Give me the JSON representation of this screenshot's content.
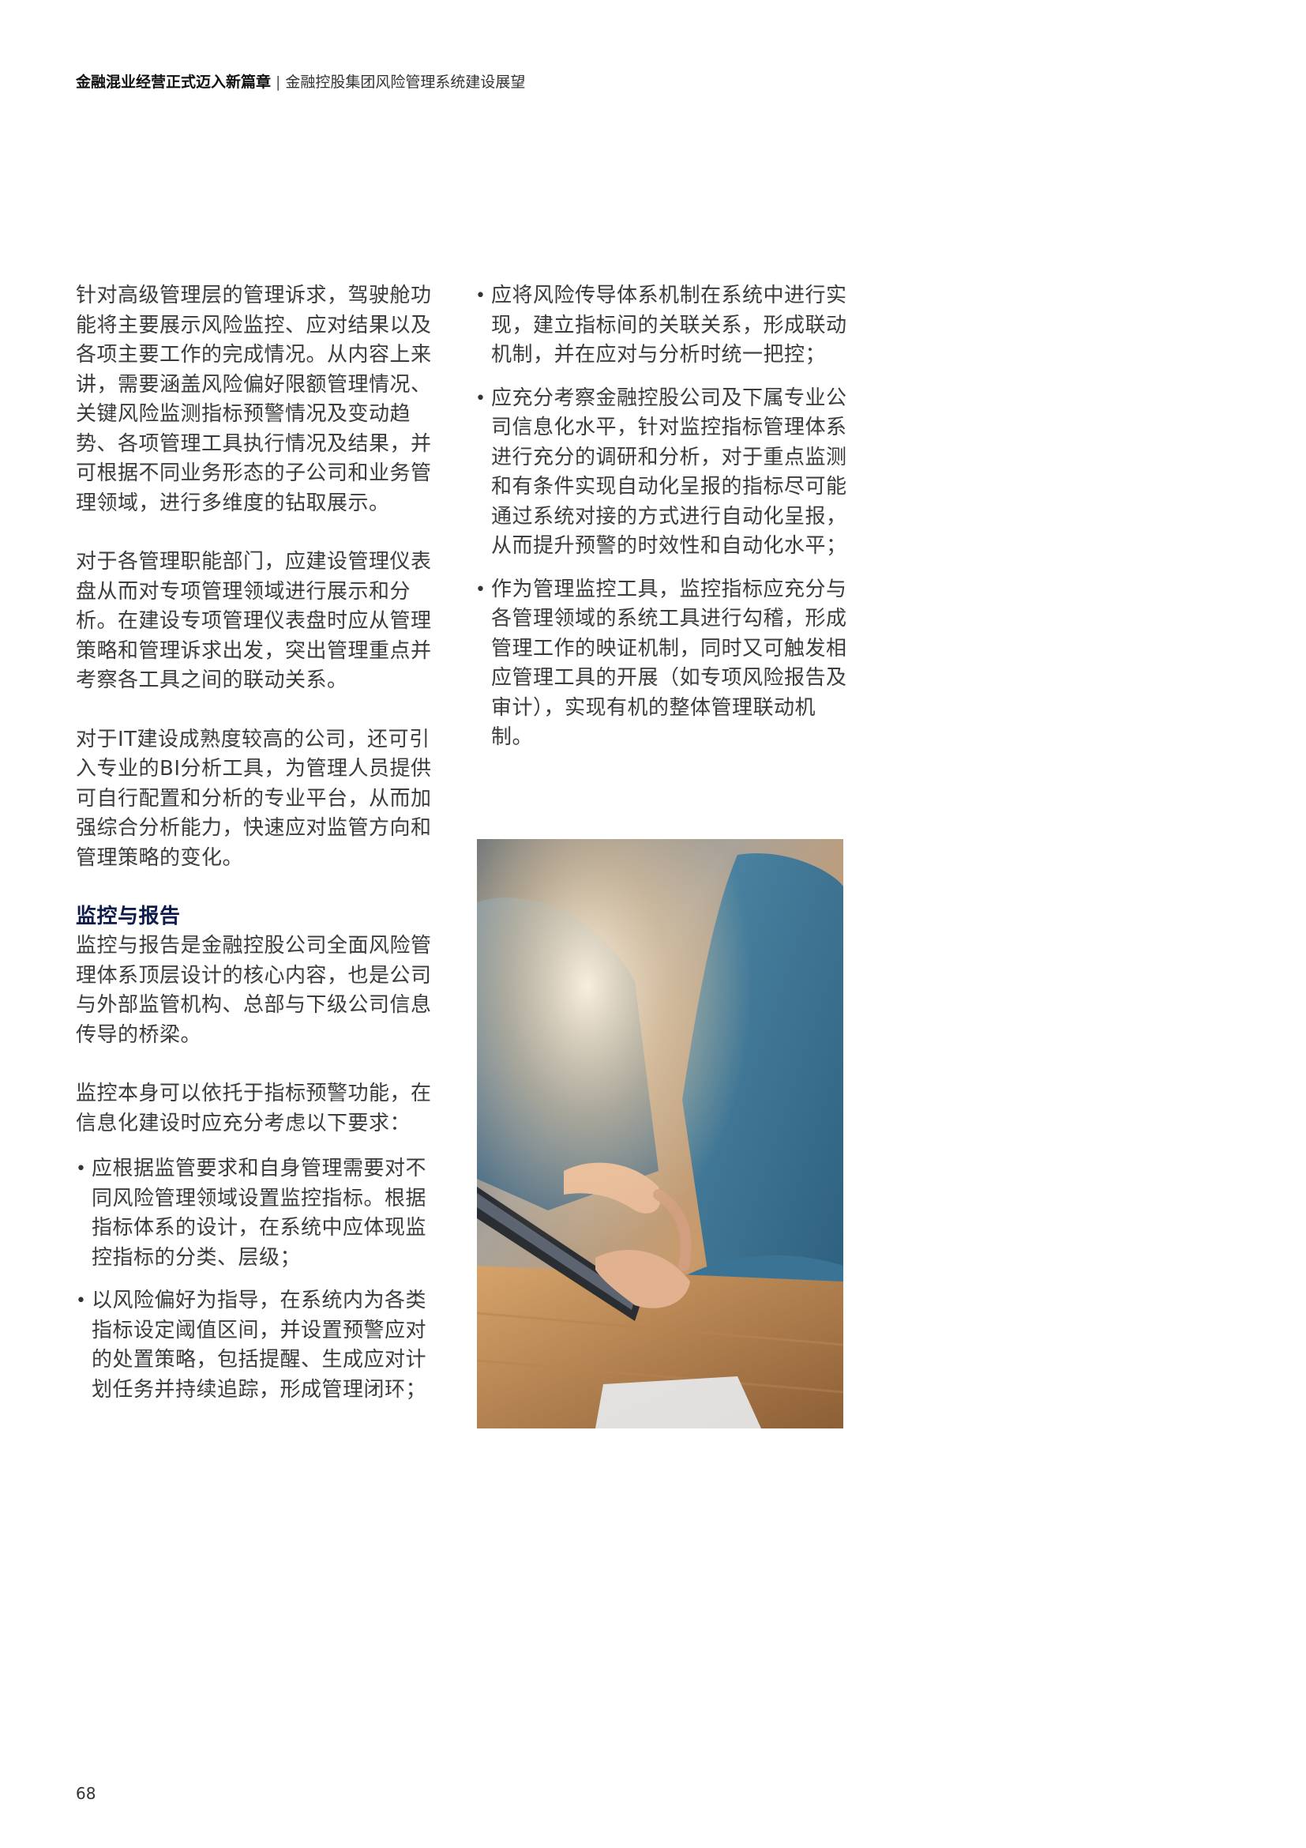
{
  "header": {
    "title": "金融混业经营正式迈入新篇章",
    "separator": "|",
    "subtitle": "金融控股集团风险管理系统建设展望"
  },
  "left_column": {
    "paragraphs": [
      "针对高级管理层的管理诉求，驾驶舱功能将主要展示风险监控、应对结果以及各项主要工作的完成情况。从内容上来讲，需要涵盖风险偏好限额管理情况、关键风险监测指标预警情况及变动趋势、各项管理工具执行情况及结果，并可根据不同业务形态的子公司和业务管理领域，进行多维度的钻取展示。",
      "对于各管理职能部门，应建设管理仪表盘从而对专项管理领域进行展示和分析。在建设专项管理仪表盘时应从管理策略和管理诉求出发，突出管理重点并考察各工具之间的联动关系。",
      "对于IT建设成熟度较高的公司，还可引入专业的BI分析工具，为管理人员提供可自行配置和分析的专业平台，从而加强综合分析能力，快速应对监管方向和管理策略的变化。"
    ],
    "section_heading": "监控与报告",
    "section_paragraphs": [
      "监控与报告是金融控股公司全面风险管理体系顶层设计的核心内容，也是公司与外部监管机构、总部与下级公司信息传导的桥梁。",
      "监控本身可以依托于指标预警功能，在信息化建设时应充分考虑以下要求："
    ],
    "bullets": [
      "应根据监管要求和自身管理需要对不同风险管理领域设置监控指标。根据指标体系的设计，在系统中应体现监控指标的分类、层级；",
      "以风险偏好为指导，在系统内为各类指标设定阈值区间，并设置预警应对的处置策略，包括提醒、生成应对计划任务并持续追踪，形成管理闭环；"
    ]
  },
  "right_column": {
    "bullets": [
      "应将风险传导体系机制在系统中进行实现，建立指标间的关联关系，形成联动机制，并在应对与分析时统一把控；",
      "应充分考察金融控股公司及下属专业公司信息化水平，针对监控指标管理体系进行充分的调研和分析，对于重点监测和有条件实现自动化呈报的指标尽可能通过系统对接的方式进行自动化呈报，从而提升预警的时效性和自动化水平；",
      "作为管理监控工具，监控指标应充分与各管理领域的系统工具进行勾稽，形成管理工作的映证机制，同时又可触发相应管理工具的开展（如专项风险报告及审计），实现有机的整体管理联动机制。"
    ]
  },
  "bullet_glyph": "•",
  "page_number": "68",
  "colors": {
    "heading": "#0f1c4b",
    "body_text": "#3c3c3c"
  }
}
